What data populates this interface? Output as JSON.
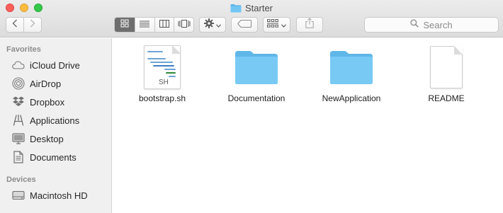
{
  "window": {
    "title": "Starter",
    "title_icon": "folder-icon"
  },
  "toolbar": {
    "back_icon": "chevron-left-icon",
    "forward_icon": "chevron-right-icon",
    "view_modes": [
      "icon-view-icon",
      "list-view-icon",
      "column-view-icon",
      "cover-flow-icon"
    ],
    "active_view": "icon-view-icon",
    "action_icon": "gear-icon",
    "tag_icon": "tag-icon",
    "arrange_icon": "arrange-grid-icon",
    "share_icon": "share-icon",
    "search_placeholder": "Search"
  },
  "sidebar": {
    "favorites_header": "Favorites",
    "favorites": [
      {
        "label": "iCloud Drive",
        "icon": "cloud-icon"
      },
      {
        "label": "AirDrop",
        "icon": "airdrop-icon"
      },
      {
        "label": "Dropbox",
        "icon": "dropbox-icon"
      },
      {
        "label": "Applications",
        "icon": "applications-icon"
      },
      {
        "label": "Desktop",
        "icon": "desktop-icon"
      },
      {
        "label": "Documents",
        "icon": "documents-icon"
      }
    ],
    "devices_header": "Devices",
    "devices": [
      {
        "label": "Macintosh HD",
        "icon": "hard-drive-icon"
      }
    ]
  },
  "files": [
    {
      "name": "bootstrap.sh",
      "kind": "script",
      "badge": "SH"
    },
    {
      "name": "Documentation",
      "kind": "folder"
    },
    {
      "name": "NewApplication",
      "kind": "folder"
    },
    {
      "name": "README",
      "kind": "document"
    }
  ],
  "colors": {
    "folder_body": "#6ac3f2",
    "folder_tab": "#5fb6e8",
    "sidebar_bg": "#f0f0f0",
    "active_segment": "#6e6e6e",
    "close": "#fc605c",
    "minimize": "#fdbc40",
    "maximize": "#34c84a"
  }
}
